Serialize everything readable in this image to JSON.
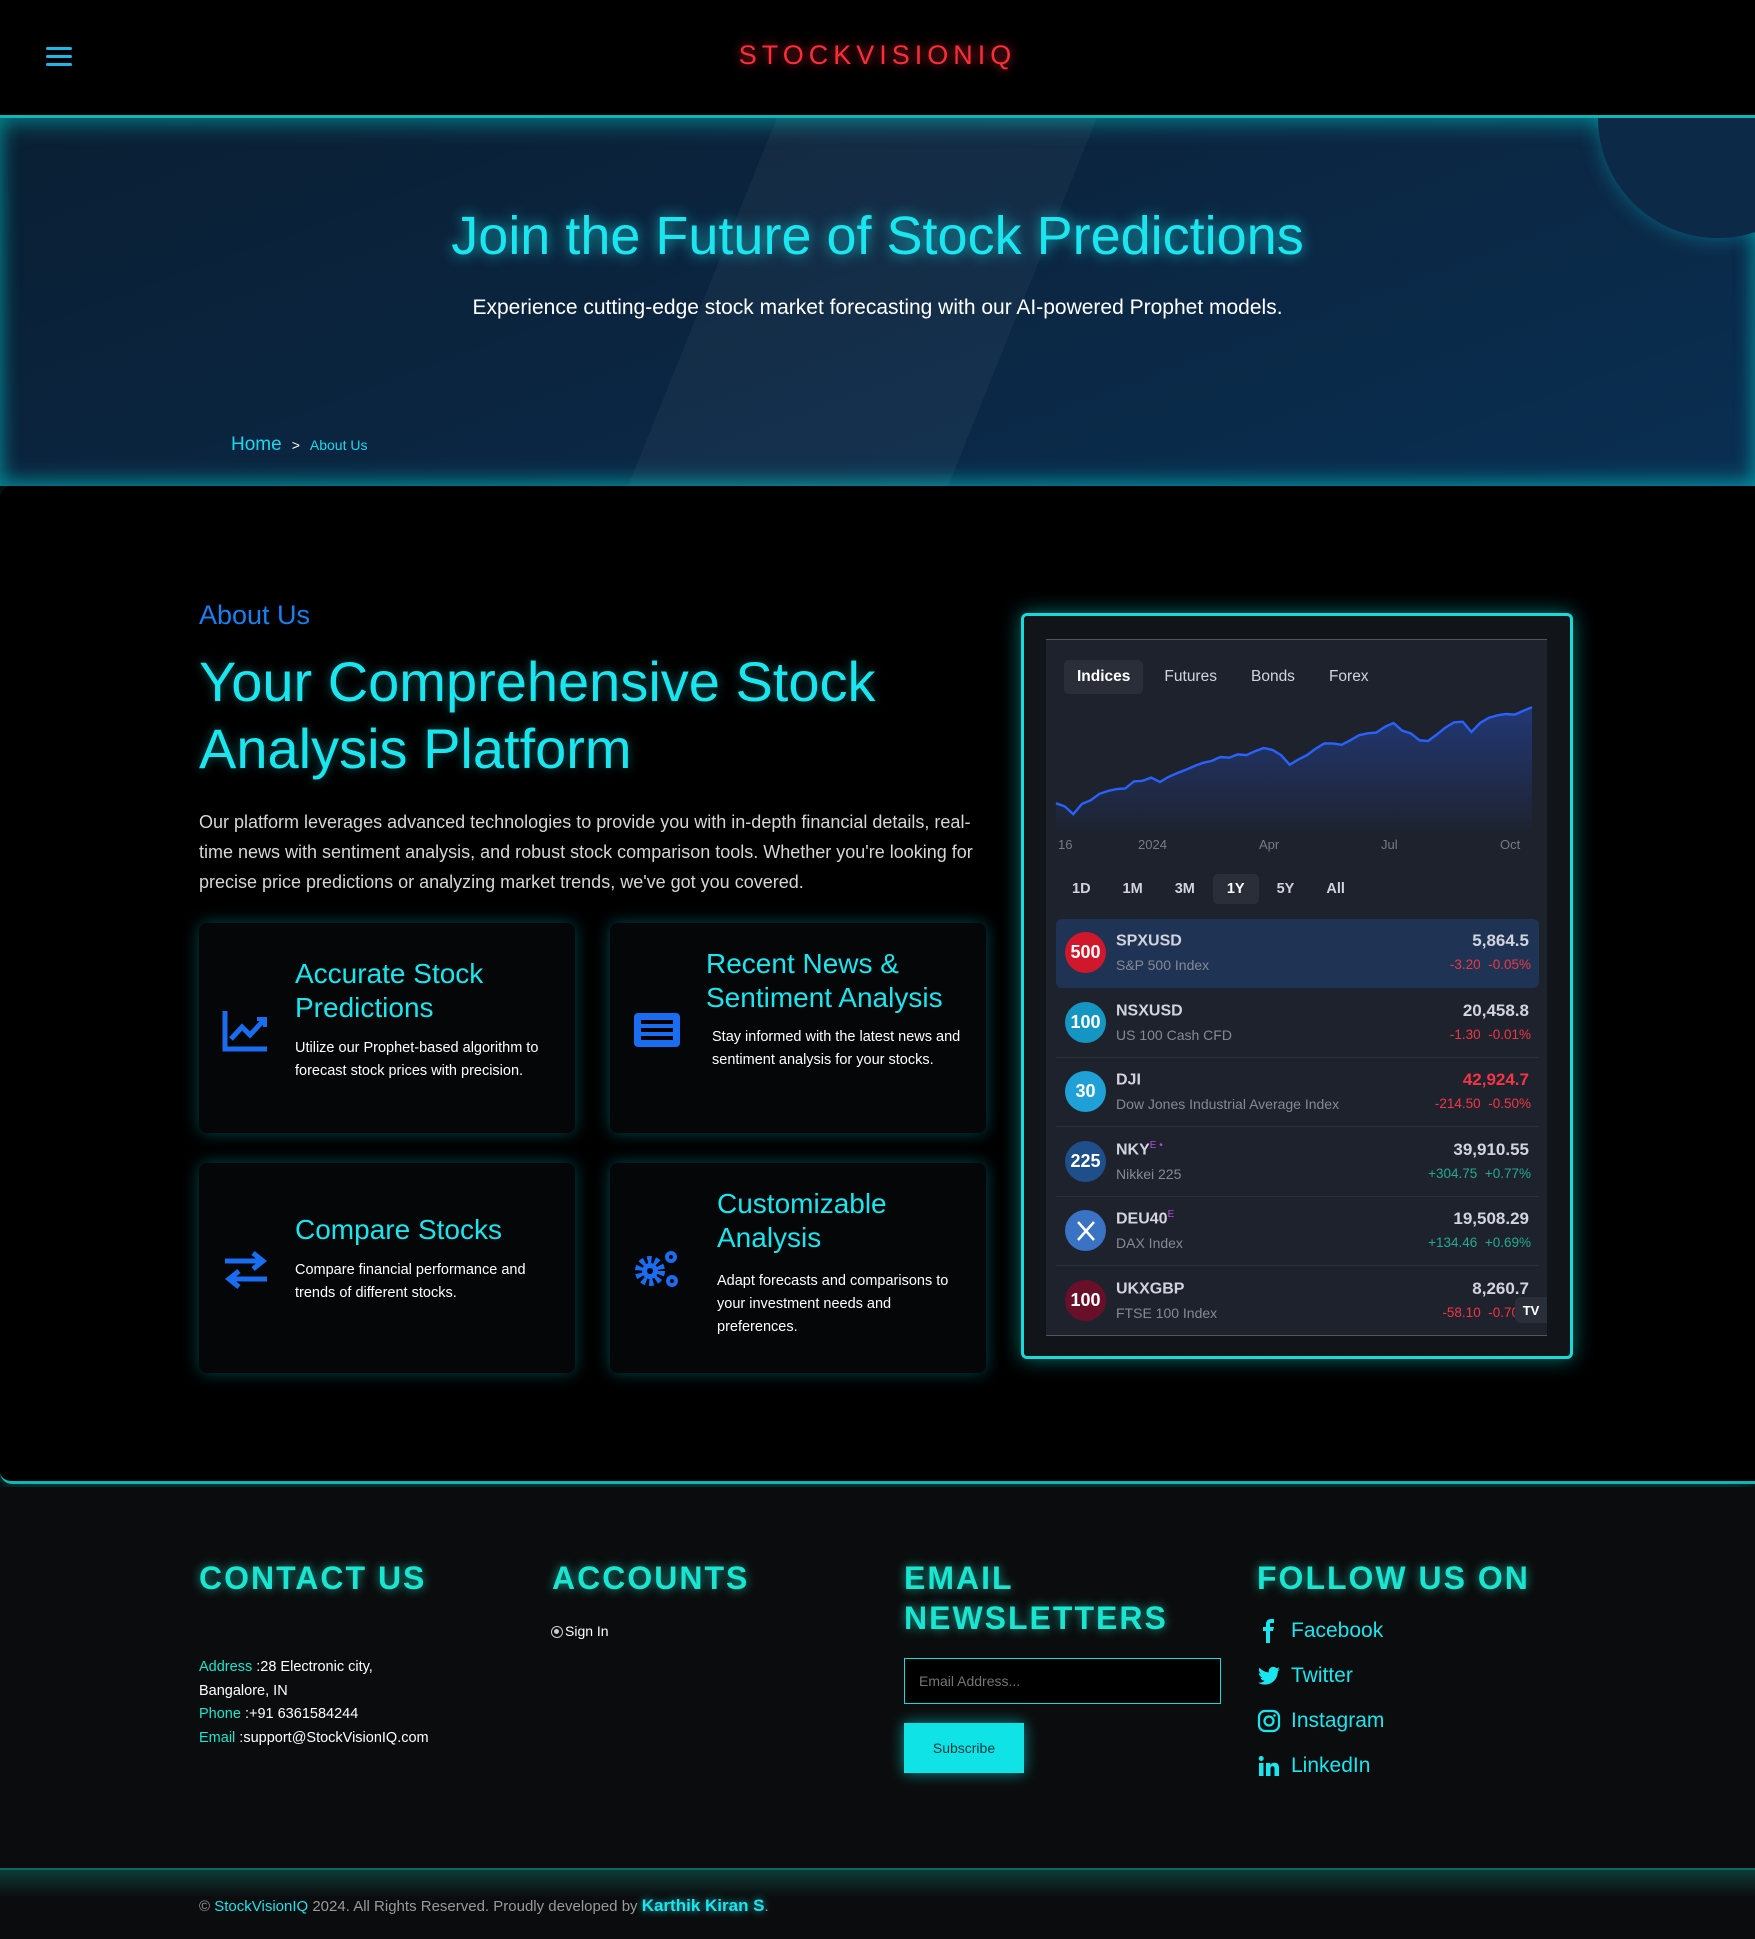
{
  "header": {
    "logo": "STOCKVISIONIQ",
    "menu_icon": "hamburger-icon"
  },
  "hero": {
    "title": "Join the Future of Stock Predictions",
    "subtitle": "Experience cutting-edge stock market forecasting with our AI-powered Prophet models.",
    "breadcrumb": {
      "home": "Home",
      "separator": ">",
      "current": "About Us"
    }
  },
  "about": {
    "label": "About Us",
    "heading": "Your Comprehensive Stock Analysis Platform",
    "paragraph": "Our platform leverages advanced technologies to provide you with in-depth financial details, real-time news with sentiment analysis, and robust stock comparison tools. Whether you're looking for precise price predictions or analyzing market trends, we've got you covered.",
    "features": [
      {
        "title": "Accurate Stock Predictions",
        "text": "Utilize our Prophet-based algorithm to forecast stock prices with precision.",
        "icon": "chart-line-icon"
      },
      {
        "title": "Recent News & Sentiment Analysis",
        "text": "Stay informed with the latest news and sentiment analysis for your stocks.",
        "icon": "newspaper-icon"
      },
      {
        "title": "Compare Stocks",
        "text": "Compare financial performance and trends of different stocks.",
        "icon": "exchange-arrows-icon"
      },
      {
        "title": "Customizable Analysis",
        "text": "Adapt forecasts and comparisons to your investment needs and preferences.",
        "icon": "gears-icon"
      }
    ]
  },
  "widget": {
    "tabs": [
      "Indices",
      "Futures",
      "Bonds",
      "Forex"
    ],
    "active_tab": "Indices",
    "ranges": [
      "1D",
      "1M",
      "3M",
      "1Y",
      "5Y",
      "All"
    ],
    "active_range": "1Y",
    "chart_data": {
      "type": "area",
      "x_ticks": [
        "16",
        "2024",
        "Apr",
        "Jul",
        "Oct"
      ],
      "line_color": "#2962ff",
      "values": [
        4370,
        4320,
        4200,
        4360,
        4415,
        4515,
        4560,
        4590,
        4600,
        4710,
        4720,
        4770,
        4700,
        4780,
        4840,
        4890,
        4950,
        5000,
        5030,
        5090,
        5080,
        5130,
        5120,
        5180,
        5230,
        5200,
        5120,
        4970,
        5050,
        5120,
        5220,
        5300,
        5300,
        5280,
        5350,
        5430,
        5460,
        5470,
        5560,
        5620,
        5500,
        5460,
        5350,
        5340,
        5440,
        5550,
        5630,
        5640,
        5480,
        5620,
        5700,
        5740,
        5760,
        5750,
        5810,
        5864.5
      ]
    },
    "rows": [
      {
        "badge": "500",
        "badge_color": "#d0172b",
        "symbol": "SPXUSD",
        "sup": "",
        "name": "S&P 500 Index",
        "price": "5,864.5",
        "change": "-3.20",
        "pct": "-0.05%",
        "dir": "neg",
        "highlight": true
      },
      {
        "badge": "100",
        "badge_color": "#1596c2",
        "symbol": "NSXUSD",
        "sup": "",
        "name": "US 100 Cash CFD",
        "price": "20,458.8",
        "change": "-1.30",
        "pct": "-0.01%",
        "dir": "neg"
      },
      {
        "badge": "30",
        "badge_color": "#1fa0d6",
        "symbol": "DJI",
        "sup": "",
        "name": "Dow Jones Industrial Average Index",
        "price": "42,924.7",
        "change": "-214.50",
        "pct": "-0.50%",
        "dir": "neg",
        "price_red": true
      },
      {
        "badge": "225",
        "badge_color": "#1e4f8a",
        "symbol": "NKY",
        "sup": "E •",
        "name": "Nikkei 225",
        "price": "39,910.55",
        "change": "+304.75",
        "pct": "+0.77%",
        "dir": "pos"
      },
      {
        "badge": "",
        "badge_color": "#3a72c4",
        "symbol": "DEU40",
        "sup": "E",
        "name": "DAX Index",
        "price": "19,508.29",
        "change": "+134.46",
        "pct": "+0.69%",
        "dir": "pos"
      },
      {
        "badge": "100",
        "badge_color": "#6a0f2a",
        "symbol": "UKXGBP",
        "sup": "",
        "name": "FTSE 100 Index",
        "price": "8,260.7",
        "change": "-58.10",
        "pct": "-0.70%",
        "dir": "neg"
      }
    ],
    "logo": "TV"
  },
  "footer": {
    "contact": {
      "heading": "CONTACT US",
      "address_label": "Address",
      "address": ":28 Electronic city,",
      "address2": "Bangalore, IN",
      "phone_label": "Phone",
      "phone": ":+91 6361584244",
      "email_label": "Email",
      "email": ":support@StockVisionIQ.com"
    },
    "accounts": {
      "heading": "ACCOUNTS",
      "sign_in": "Sign In"
    },
    "newsletter": {
      "heading": "EMAIL NEWSLETTERS",
      "placeholder": "Email Address...",
      "button": "Subscribe"
    },
    "follow": {
      "heading": "FOLLOW US ON",
      "links": [
        "Facebook",
        "Twitter",
        "Instagram",
        "LinkedIn"
      ]
    },
    "copyright": {
      "prefix": "©",
      "brand": "StockVisionIQ",
      "text": " 2024. All Rights Reserved. Proudly developed by ",
      "developer": "Karthik Kiran S",
      "suffix": "."
    }
  }
}
